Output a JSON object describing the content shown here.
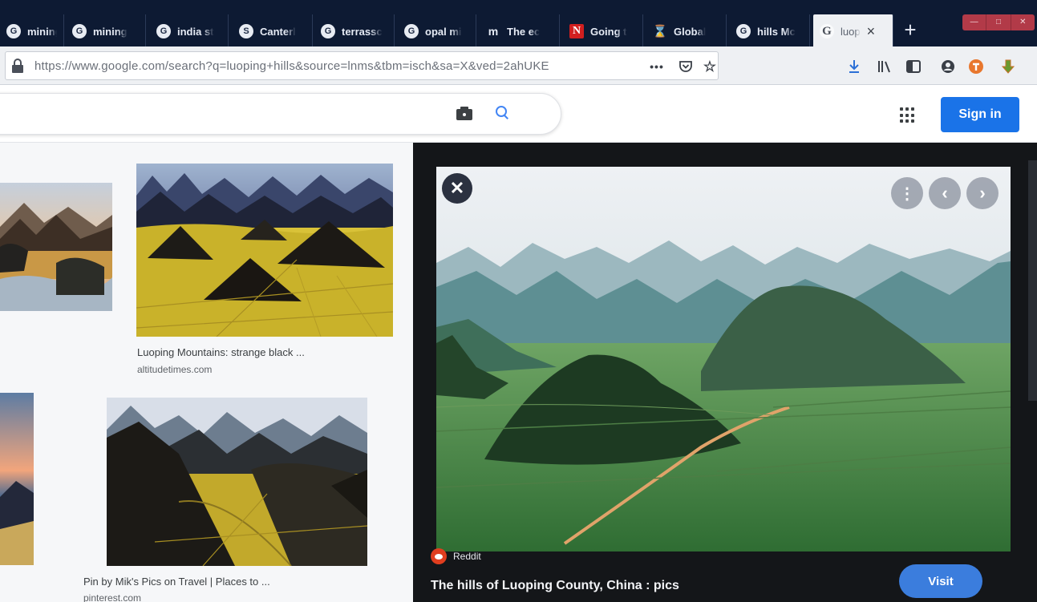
{
  "tabs": [
    {
      "label": "mining",
      "favicon": "google-icon"
    },
    {
      "label": "mining",
      "favicon": "google-icon"
    },
    {
      "label": "india st",
      "favicon": "google-icon"
    },
    {
      "label": "Canterl",
      "favicon": "s-site-icon"
    },
    {
      "label": "terrassc",
      "favicon": "google-icon"
    },
    {
      "label": "opal mi",
      "favicon": "google-icon"
    },
    {
      "label": "The ec",
      "favicon": "m-site-icon"
    },
    {
      "label": "Going t",
      "favicon": "netflix-icon"
    },
    {
      "label": "Global",
      "favicon": "hourglass-icon"
    },
    {
      "label": "hills Mc",
      "favicon": "google-icon"
    },
    {
      "label": "luop",
      "favicon": "google-icon",
      "active": true
    }
  ],
  "browser": {
    "url": "https://www.google.com/search?q=luoping+hills&source=lnms&tbm=isch&sa=X&ved=2ahUKE",
    "page_actions_label": "•••"
  },
  "google": {
    "signin_label": "Sign in"
  },
  "results": [
    {
      "caption": "Luoping Mountains: strange black ...",
      "source": "altitudetimes.com"
    },
    {
      "caption": "Pin by Mik's Pics on Travel | Places to ...",
      "source": "pinterest.com"
    }
  ],
  "preview": {
    "site": "Reddit",
    "title": "The hills of Luoping County, China : pics",
    "visit_label": "Visit"
  },
  "colors": {
    "tabstrip": "#0d1a33",
    "signin_blue": "#1a73e8",
    "visit_blue": "#3b7ddd",
    "reddit_orange": "#e03e1f"
  }
}
